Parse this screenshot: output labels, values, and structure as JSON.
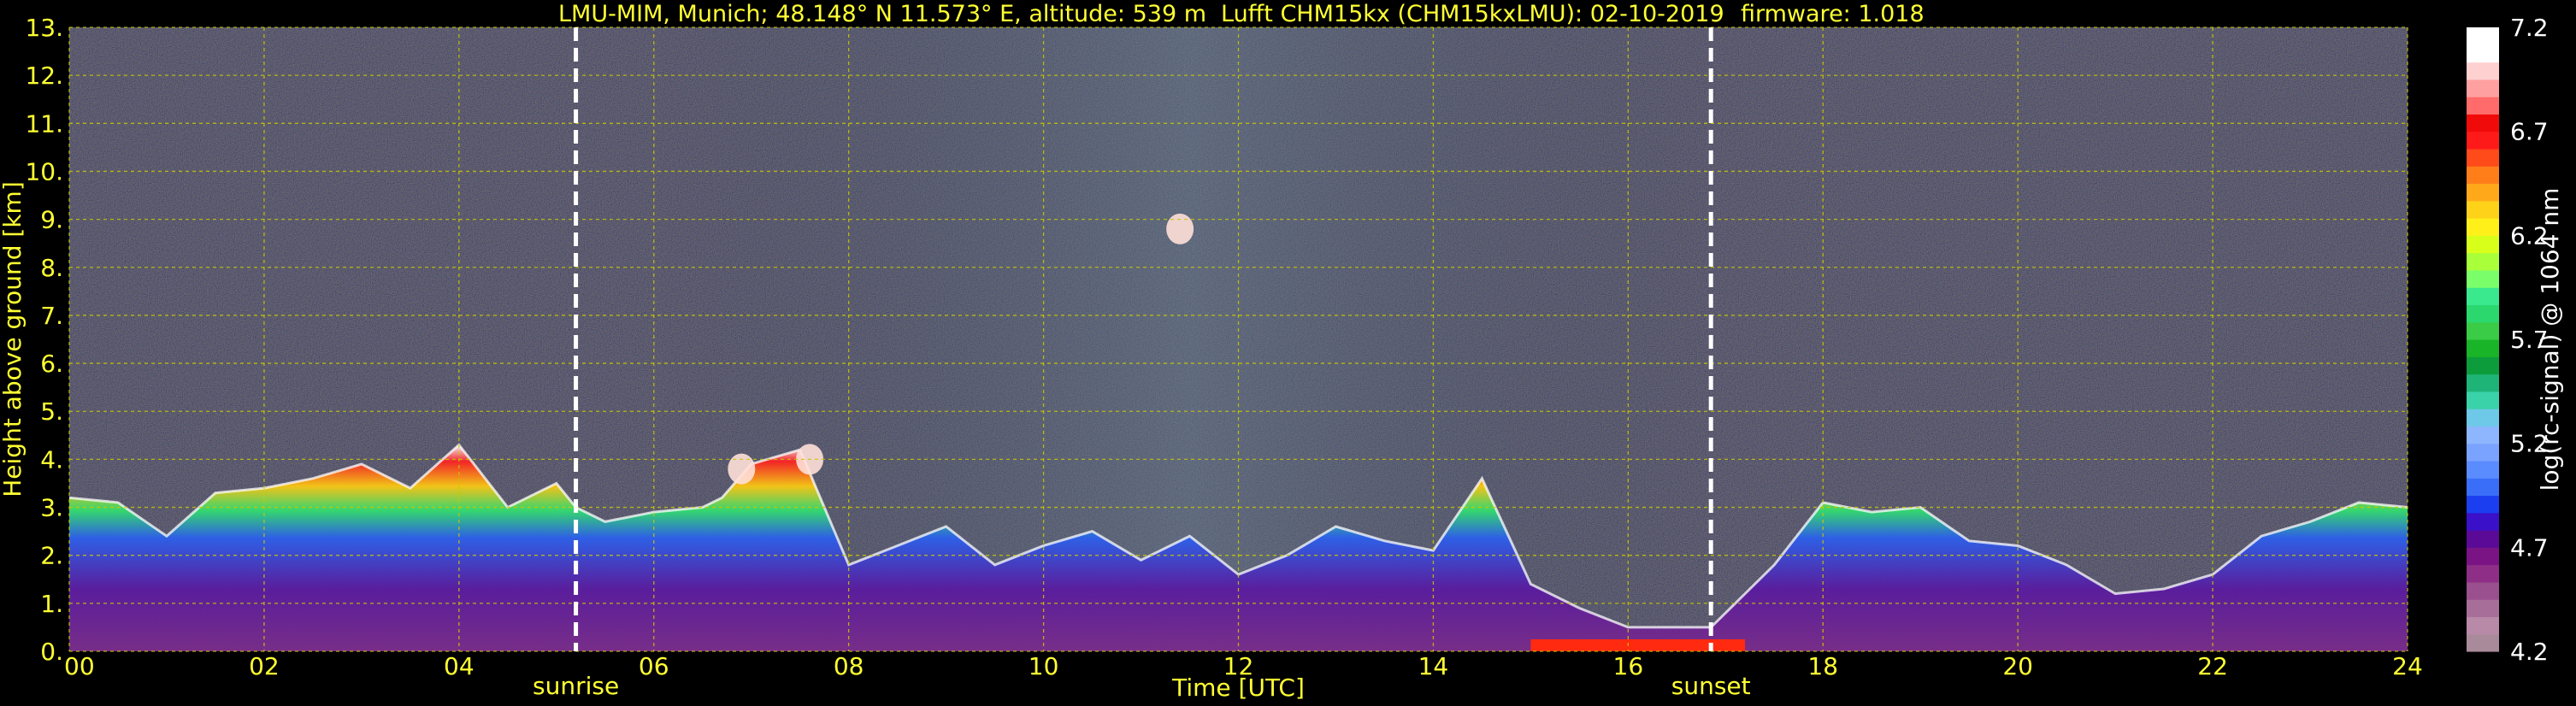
{
  "title": {
    "site": "LMU-MIM, Munich; 48.148° N 11.573° E, altitude: 539 m",
    "instrument": "Lufft CHM15kx (CHM15kxLMU): 02-10-2019",
    "firmware": "firmware: 1.018"
  },
  "colors": {
    "background": "#000000",
    "axis_text": "#ffff33",
    "grid": "#c8c800",
    "marker": "#ffffff"
  },
  "chart_data": {
    "type": "heatmap",
    "xlabel": "Time [UTC]",
    "ylabel": "Height above ground [km]",
    "xlim": [
      0,
      24
    ],
    "ylim": [
      0,
      13
    ],
    "x_ticks": [
      "00",
      "02",
      "04",
      "06",
      "08",
      "10",
      "12",
      "14",
      "16",
      "18",
      "20",
      "22",
      "24"
    ],
    "y_ticks": [
      "0.",
      "1.",
      "2.",
      "3.",
      "4.",
      "5.",
      "6.",
      "7.",
      "8.",
      "9.",
      "10.",
      "11.",
      "12.",
      "13."
    ],
    "grid": true,
    "markers": [
      {
        "label": "sunrise",
        "time_h": 5.2
      },
      {
        "label": "sunset",
        "time_h": 16.85
      }
    ],
    "colorbar": {
      "label": "log(rc-signal) @ 1064 nm",
      "range": [
        4.2,
        7.2
      ],
      "ticks": [
        "7.2",
        "6.7",
        "6.2",
        "5.7",
        "5.2",
        "4.7",
        "4.2"
      ],
      "colors": [
        "#a88a9a",
        "#b88aa8",
        "#a86e9a",
        "#9a4f8e",
        "#8e2e86",
        "#7a1484",
        "#5a0a96",
        "#3a10c8",
        "#1a3ef0",
        "#3a6ef8",
        "#5a8cff",
        "#7aa2ff",
        "#8eb6ff",
        "#6ec8e8",
        "#3ad2a8",
        "#1eb478",
        "#0c9c3c",
        "#1ab428",
        "#3acc46",
        "#2ad86e",
        "#3ae88e",
        "#7aff6a",
        "#a8ff3a",
        "#d8ff1a",
        "#fff01a",
        "#ffd21a",
        "#ffa81a",
        "#ff7e1a",
        "#ff4a1a",
        "#ff1a1a",
        "#f00a0a",
        "#ff6a6a",
        "#ffa0a0",
        "#ffd0d0",
        "#ffffff",
        "#ffffff"
      ]
    },
    "aerosol_layer_top_km": [
      [
        0,
        3.2
      ],
      [
        0.5,
        3.1
      ],
      [
        1,
        2.4
      ],
      [
        1.5,
        3.3
      ],
      [
        2,
        3.4
      ],
      [
        2.5,
        3.6
      ],
      [
        3,
        3.9
      ],
      [
        3.5,
        3.4
      ],
      [
        4,
        4.3
      ],
      [
        4.5,
        3.0
      ],
      [
        5,
        3.5
      ],
      [
        5.2,
        3.0
      ],
      [
        5.5,
        2.7
      ],
      [
        6,
        2.9
      ],
      [
        6.5,
        3.0
      ],
      [
        6.7,
        3.2
      ],
      [
        7,
        3.9
      ],
      [
        7.5,
        4.2
      ],
      [
        8,
        1.8
      ],
      [
        8.5,
        2.2
      ],
      [
        9,
        2.6
      ],
      [
        9.5,
        1.8
      ],
      [
        10,
        2.2
      ],
      [
        10.5,
        2.5
      ],
      [
        11,
        1.9
      ],
      [
        11.5,
        2.4
      ],
      [
        12,
        1.6
      ],
      [
        12.5,
        2.0
      ],
      [
        13,
        2.6
      ],
      [
        13.5,
        2.3
      ],
      [
        14,
        2.1
      ],
      [
        14.5,
        3.6
      ],
      [
        15,
        1.4
      ],
      [
        15.5,
        0.9
      ],
      [
        16,
        0.5
      ],
      [
        16.85,
        0.5
      ],
      [
        17.5,
        1.8
      ],
      [
        18,
        3.1
      ],
      [
        18.5,
        2.9
      ],
      [
        19,
        3.0
      ],
      [
        19.5,
        2.3
      ],
      [
        20,
        2.2
      ],
      [
        20.5,
        1.8
      ],
      [
        21,
        1.2
      ],
      [
        21.5,
        1.3
      ],
      [
        22,
        1.6
      ],
      [
        22.5,
        2.4
      ],
      [
        23,
        2.7
      ],
      [
        23.5,
        3.1
      ],
      [
        24,
        3.0
      ]
    ],
    "cirrus_patches": [
      {
        "time_h": 11.4,
        "height_km": 8.8,
        "intensity": 6.9
      },
      {
        "time_h": 7.6,
        "height_km": 4.0,
        "intensity": 7.0
      },
      {
        "time_h": 6.9,
        "height_km": 3.8,
        "intensity": 6.7
      }
    ]
  }
}
